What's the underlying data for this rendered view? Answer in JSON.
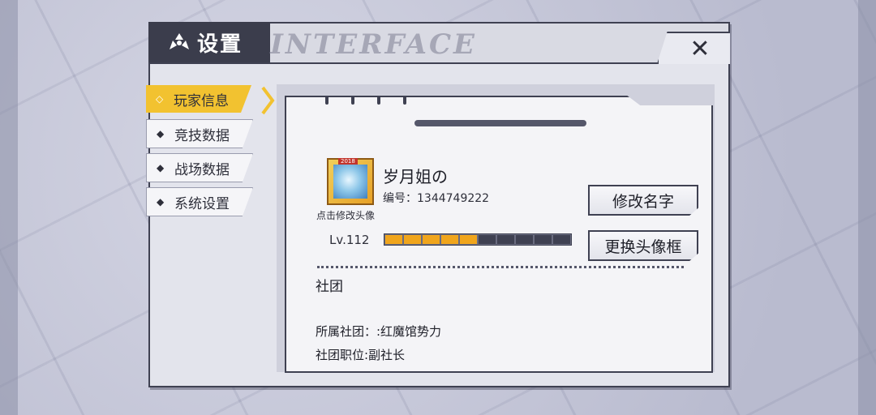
{
  "window": {
    "title": "设置",
    "watermark": "INTERFACE",
    "close_glyph": "✕"
  },
  "tabs": [
    {
      "label": "玩家信息",
      "active": true
    },
    {
      "label": "竞技数据",
      "active": false
    },
    {
      "label": "战场数据",
      "active": false
    },
    {
      "label": "系统设置",
      "active": false
    }
  ],
  "profile": {
    "name": "岁月姐の",
    "id_text": "编号：1344749222",
    "avatar_caption": "点击修改头像",
    "avatar_badge": "2018",
    "level_text": "Lv.112",
    "xp_filled_segments": 5,
    "xp_total_segments": 10
  },
  "buttons": {
    "rename": "修改名字",
    "change_frame": "更换头像框"
  },
  "club": {
    "section_title": "社团",
    "belong": "所属社团：:红魔馆势力",
    "position": "社团职位:副社长"
  },
  "colors": {
    "accent_yellow": "#f2c230",
    "xp_fill": "#f0a51c",
    "xp_empty": "#3f4152",
    "frame_dark": "#3f4152"
  },
  "icons": {
    "title": "radiation-icon",
    "close": "close-icon",
    "tab_bullet": "diamond-icon"
  }
}
